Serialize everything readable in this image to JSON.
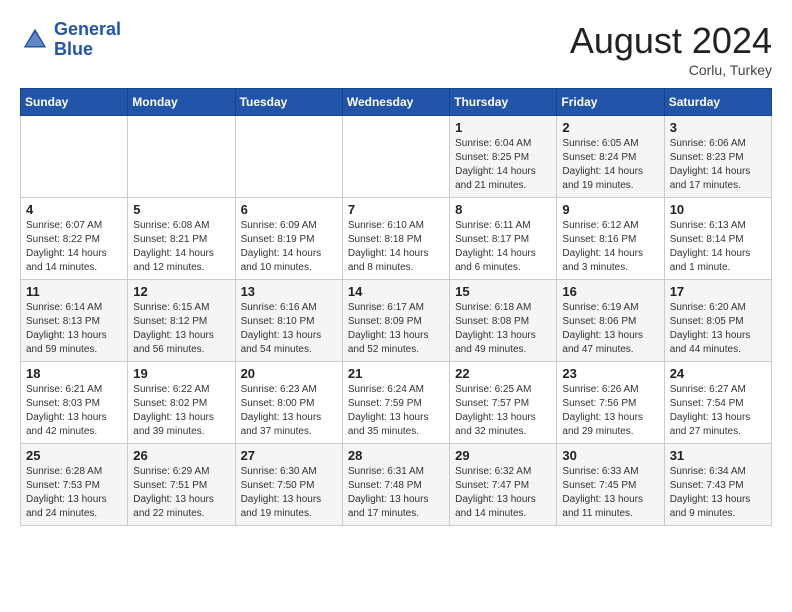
{
  "header": {
    "logo_line1": "General",
    "logo_line2": "Blue",
    "month": "August 2024",
    "location": "Corlu, Turkey"
  },
  "weekdays": [
    "Sunday",
    "Monday",
    "Tuesday",
    "Wednesday",
    "Thursday",
    "Friday",
    "Saturday"
  ],
  "weeks": [
    [
      {
        "day": "",
        "info": ""
      },
      {
        "day": "",
        "info": ""
      },
      {
        "day": "",
        "info": ""
      },
      {
        "day": "",
        "info": ""
      },
      {
        "day": "1",
        "info": "Sunrise: 6:04 AM\nSunset: 8:25 PM\nDaylight: 14 hours\nand 21 minutes."
      },
      {
        "day": "2",
        "info": "Sunrise: 6:05 AM\nSunset: 8:24 PM\nDaylight: 14 hours\nand 19 minutes."
      },
      {
        "day": "3",
        "info": "Sunrise: 6:06 AM\nSunset: 8:23 PM\nDaylight: 14 hours\nand 17 minutes."
      }
    ],
    [
      {
        "day": "4",
        "info": "Sunrise: 6:07 AM\nSunset: 8:22 PM\nDaylight: 14 hours\nand 14 minutes."
      },
      {
        "day": "5",
        "info": "Sunrise: 6:08 AM\nSunset: 8:21 PM\nDaylight: 14 hours\nand 12 minutes."
      },
      {
        "day": "6",
        "info": "Sunrise: 6:09 AM\nSunset: 8:19 PM\nDaylight: 14 hours\nand 10 minutes."
      },
      {
        "day": "7",
        "info": "Sunrise: 6:10 AM\nSunset: 8:18 PM\nDaylight: 14 hours\nand 8 minutes."
      },
      {
        "day": "8",
        "info": "Sunrise: 6:11 AM\nSunset: 8:17 PM\nDaylight: 14 hours\nand 6 minutes."
      },
      {
        "day": "9",
        "info": "Sunrise: 6:12 AM\nSunset: 8:16 PM\nDaylight: 14 hours\nand 3 minutes."
      },
      {
        "day": "10",
        "info": "Sunrise: 6:13 AM\nSunset: 8:14 PM\nDaylight: 14 hours\nand 1 minute."
      }
    ],
    [
      {
        "day": "11",
        "info": "Sunrise: 6:14 AM\nSunset: 8:13 PM\nDaylight: 13 hours\nand 59 minutes."
      },
      {
        "day": "12",
        "info": "Sunrise: 6:15 AM\nSunset: 8:12 PM\nDaylight: 13 hours\nand 56 minutes."
      },
      {
        "day": "13",
        "info": "Sunrise: 6:16 AM\nSunset: 8:10 PM\nDaylight: 13 hours\nand 54 minutes."
      },
      {
        "day": "14",
        "info": "Sunrise: 6:17 AM\nSunset: 8:09 PM\nDaylight: 13 hours\nand 52 minutes."
      },
      {
        "day": "15",
        "info": "Sunrise: 6:18 AM\nSunset: 8:08 PM\nDaylight: 13 hours\nand 49 minutes."
      },
      {
        "day": "16",
        "info": "Sunrise: 6:19 AM\nSunset: 8:06 PM\nDaylight: 13 hours\nand 47 minutes."
      },
      {
        "day": "17",
        "info": "Sunrise: 6:20 AM\nSunset: 8:05 PM\nDaylight: 13 hours\nand 44 minutes."
      }
    ],
    [
      {
        "day": "18",
        "info": "Sunrise: 6:21 AM\nSunset: 8:03 PM\nDaylight: 13 hours\nand 42 minutes."
      },
      {
        "day": "19",
        "info": "Sunrise: 6:22 AM\nSunset: 8:02 PM\nDaylight: 13 hours\nand 39 minutes."
      },
      {
        "day": "20",
        "info": "Sunrise: 6:23 AM\nSunset: 8:00 PM\nDaylight: 13 hours\nand 37 minutes."
      },
      {
        "day": "21",
        "info": "Sunrise: 6:24 AM\nSunset: 7:59 PM\nDaylight: 13 hours\nand 35 minutes."
      },
      {
        "day": "22",
        "info": "Sunrise: 6:25 AM\nSunset: 7:57 PM\nDaylight: 13 hours\nand 32 minutes."
      },
      {
        "day": "23",
        "info": "Sunrise: 6:26 AM\nSunset: 7:56 PM\nDaylight: 13 hours\nand 29 minutes."
      },
      {
        "day": "24",
        "info": "Sunrise: 6:27 AM\nSunset: 7:54 PM\nDaylight: 13 hours\nand 27 minutes."
      }
    ],
    [
      {
        "day": "25",
        "info": "Sunrise: 6:28 AM\nSunset: 7:53 PM\nDaylight: 13 hours\nand 24 minutes."
      },
      {
        "day": "26",
        "info": "Sunrise: 6:29 AM\nSunset: 7:51 PM\nDaylight: 13 hours\nand 22 minutes."
      },
      {
        "day": "27",
        "info": "Sunrise: 6:30 AM\nSunset: 7:50 PM\nDaylight: 13 hours\nand 19 minutes."
      },
      {
        "day": "28",
        "info": "Sunrise: 6:31 AM\nSunset: 7:48 PM\nDaylight: 13 hours\nand 17 minutes."
      },
      {
        "day": "29",
        "info": "Sunrise: 6:32 AM\nSunset: 7:47 PM\nDaylight: 13 hours\nand 14 minutes."
      },
      {
        "day": "30",
        "info": "Sunrise: 6:33 AM\nSunset: 7:45 PM\nDaylight: 13 hours\nand 11 minutes."
      },
      {
        "day": "31",
        "info": "Sunrise: 6:34 AM\nSunset: 7:43 PM\nDaylight: 13 hours\nand 9 minutes."
      }
    ]
  ]
}
